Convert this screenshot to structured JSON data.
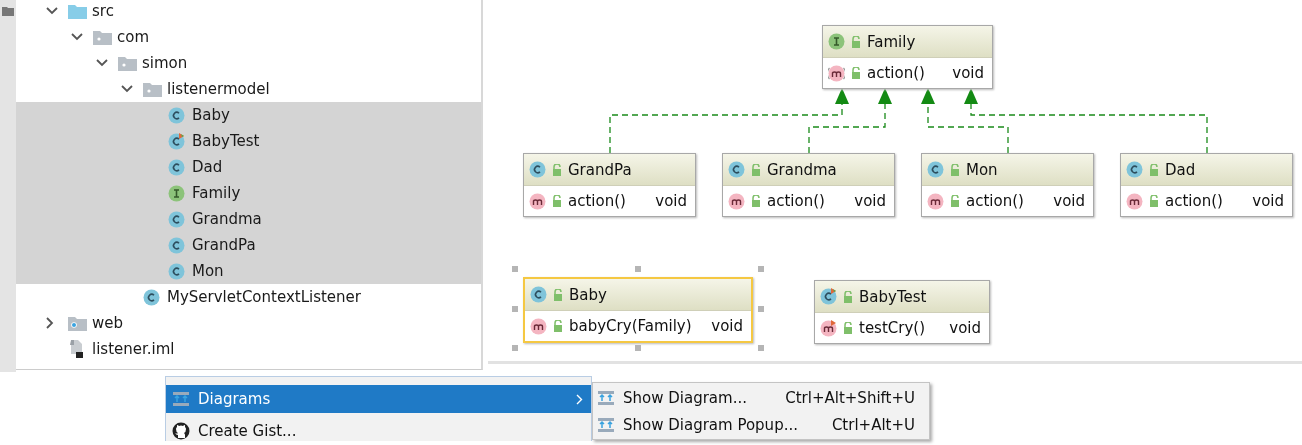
{
  "project_tree": {
    "items": [
      {
        "label": "src",
        "kind": "source-folder",
        "expanded": true,
        "selected": false,
        "children": [
          {
            "label": "com",
            "kind": "package",
            "expanded": true,
            "selected": false,
            "children": [
              {
                "label": "simon",
                "kind": "package",
                "expanded": true,
                "selected": false,
                "children": [
                  {
                    "label": "listenermodel",
                    "kind": "package",
                    "expanded": true,
                    "selected": false,
                    "children": [
                      {
                        "label": "Baby",
                        "kind": "class",
                        "selected": true
                      },
                      {
                        "label": "BabyTest",
                        "kind": "test-class",
                        "selected": true
                      },
                      {
                        "label": "Dad",
                        "kind": "class",
                        "selected": true
                      },
                      {
                        "label": "Family",
                        "kind": "interface",
                        "selected": true
                      },
                      {
                        "label": "Grandma",
                        "kind": "class",
                        "selected": true
                      },
                      {
                        "label": "GrandPa",
                        "kind": "class",
                        "selected": true
                      },
                      {
                        "label": "Mon",
                        "kind": "class",
                        "selected": true
                      }
                    ]
                  },
                  {
                    "label": "MyServletContextListener",
                    "kind": "class",
                    "selected": false
                  }
                ]
              }
            ]
          }
        ]
      },
      {
        "label": "web",
        "kind": "web-folder",
        "expanded": false,
        "selected": false
      },
      {
        "label": "listener.iml",
        "kind": "module-file",
        "selected": false
      }
    ]
  },
  "diagram": {
    "nodes": [
      {
        "name": "Family",
        "kind": "interface",
        "selected": false,
        "members": [
          {
            "name": "action()",
            "type": "void",
            "kind": "abstract-method"
          }
        ]
      },
      {
        "name": "GrandPa",
        "kind": "class",
        "selected": false,
        "members": [
          {
            "name": "action()",
            "type": "void",
            "kind": "method"
          }
        ]
      },
      {
        "name": "Grandma",
        "kind": "class",
        "selected": false,
        "members": [
          {
            "name": "action()",
            "type": "void",
            "kind": "method"
          }
        ]
      },
      {
        "name": "Mon",
        "kind": "class",
        "selected": false,
        "members": [
          {
            "name": "action()",
            "type": "void",
            "kind": "method"
          }
        ]
      },
      {
        "name": "Dad",
        "kind": "class",
        "selected": false,
        "members": [
          {
            "name": "action()",
            "type": "void",
            "kind": "method"
          }
        ]
      },
      {
        "name": "Baby",
        "kind": "class",
        "selected": true,
        "members": [
          {
            "name": "babyCry(Family)",
            "type": "void",
            "kind": "method"
          }
        ]
      },
      {
        "name": "BabyTest",
        "kind": "test-class",
        "selected": false,
        "members": [
          {
            "name": "testCry()",
            "type": "void",
            "kind": "test-method"
          }
        ]
      }
    ],
    "edges": [
      {
        "kind": "realization"
      },
      {
        "kind": "realization"
      },
      {
        "kind": "realization"
      },
      {
        "kind": "realization"
      }
    ]
  },
  "context_menu": {
    "items": [
      {
        "label": "Diagrams",
        "kind": "diagram",
        "selected": true,
        "has_submenu": true
      },
      {
        "label": "Create Gist...",
        "kind": "github",
        "selected": false,
        "has_submenu": false
      }
    ],
    "submenu": {
      "items": [
        {
          "label": "Show Diagram...",
          "shortcut": "Ctrl+Alt+Shift+U",
          "selected": false
        },
        {
          "label": "Show Diagram Popup...",
          "shortcut": "Ctrl+Alt+U",
          "selected": false
        }
      ]
    }
  }
}
